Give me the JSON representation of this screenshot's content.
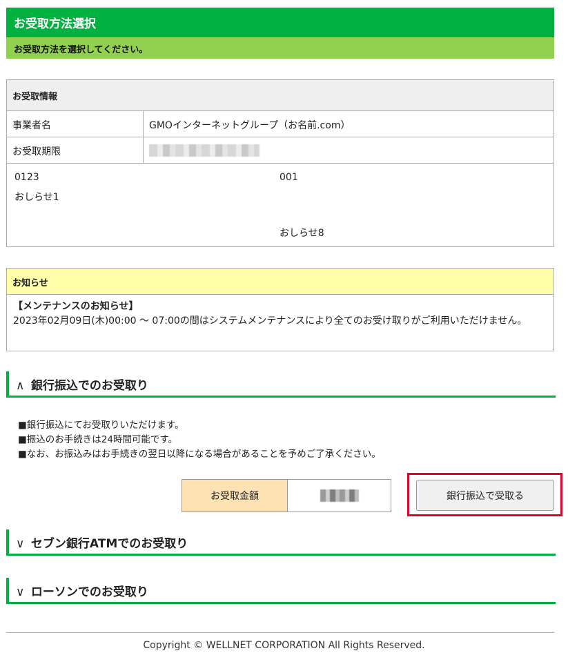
{
  "header": {
    "title": "お受取方法選択",
    "instruction": "お受取方法を選択してください。"
  },
  "info": {
    "heading": "お受取情報",
    "rows": [
      {
        "label": "事業者名",
        "value": "GMOインターネットグループ（お名前.com）"
      },
      {
        "label": "お受取期限",
        "value": ""
      }
    ],
    "extra": {
      "left_code": "0123",
      "left_note": "おしらせ1",
      "right_code": "001",
      "right_note": "おしらせ8"
    }
  },
  "notice": {
    "heading": "お知らせ",
    "title": "【メンテナンスのお知らせ】",
    "body": "2023年02月09日(木)00:00 ～ 07:00の間はシステムメンテナンスにより全てのお受け取りがご利用いただけません。"
  },
  "sections": [
    {
      "chevron": "∧",
      "title": "銀行振込でのお受取り",
      "expanded": true
    },
    {
      "chevron": "∨",
      "title": "セブン銀行ATMでのお受取り",
      "expanded": false
    },
    {
      "chevron": "∨",
      "title": "ローソンでのお受取り",
      "expanded": false
    }
  ],
  "bank": {
    "notes": [
      "■銀行振込にてお受取りいただけます。",
      "■振込のお手続きは24時間可能です。",
      "■なお、お振込みはお手続きの翌日以降になる場合があることを予めご了承ください。"
    ],
    "amount_label": "お受取金額",
    "amount_value": "",
    "button_label": "銀行振込で受取る"
  },
  "footer": {
    "copyright": "Copyright © WELLNET CORPORATION All Rights Reserved."
  },
  "colors": {
    "primary_green": "#00b140",
    "light_green": "#92d050",
    "notice_yellow": "#ffffaa",
    "amount_orange": "#fde1b3",
    "highlight_red": "#e4002b"
  }
}
